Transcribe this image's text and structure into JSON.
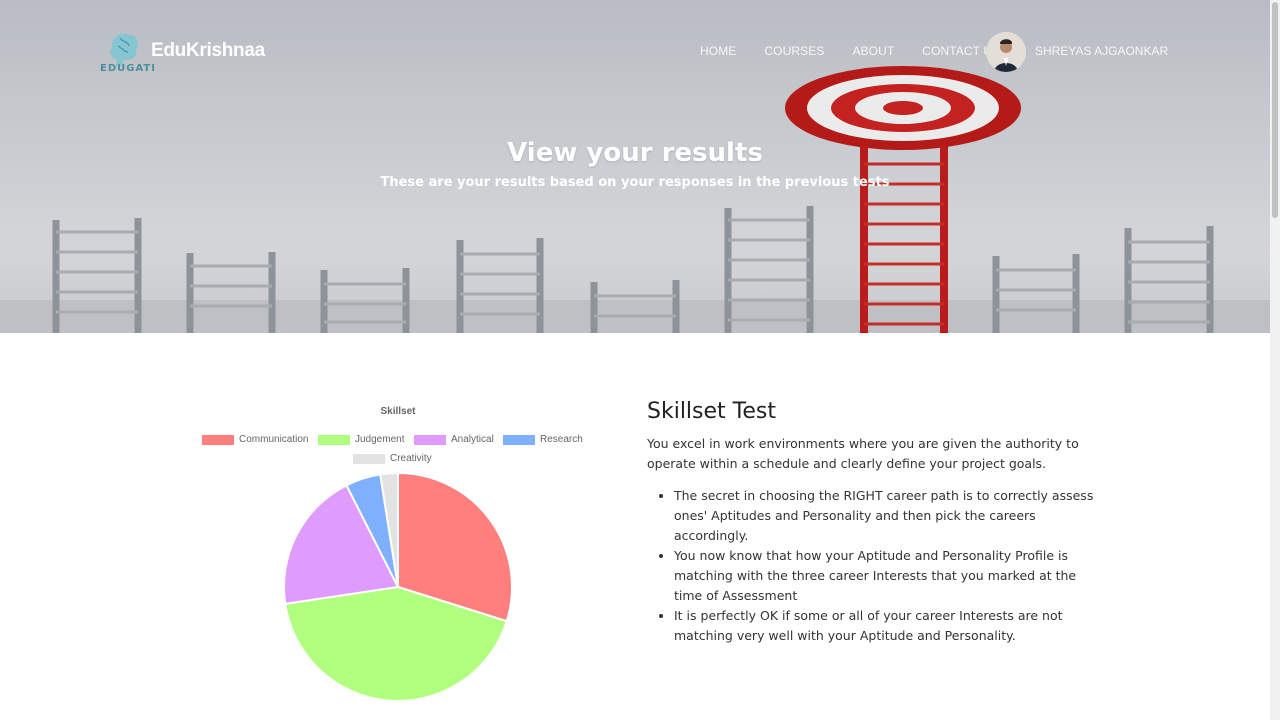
{
  "brand": {
    "name": "EduKrishnaa",
    "logo_caption": "EDUGATI",
    "logo_icon": "brain-icon"
  },
  "nav": {
    "items": [
      "HOME",
      "COURSES",
      "ABOUT",
      "CONTACT US"
    ],
    "user_name": "SHREYAS AJGAONKAR"
  },
  "hero": {
    "title": "View your results",
    "subtitle": "These are your results based on your responses in the previous tests"
  },
  "chart_data": {
    "type": "pie",
    "title": "Skillset",
    "categories": [
      "Communication",
      "Judgement",
      "Analytical",
      "Research",
      "Creativity"
    ],
    "values": [
      30,
      43,
      20,
      5,
      2.5
    ],
    "colors": [
      "#ff7f7f",
      "#b0ff7f",
      "#e09bff",
      "#7fb0ff",
      "#e3e3e3"
    ],
    "legend_position": "top"
  },
  "result": {
    "heading": "Skillset Test",
    "summary": "You excel in work environments where you are given the authority to operate within a schedule and clearly define your project goals.",
    "points": [
      "The secret in choosing the RIGHT career path is to correctly assess ones' Aptitudes and Personality and then pick the careers accordingly.",
      "You now know that how your Aptitude and Personality Profile is matching with the three career Interests that you marked at the time of Assessment",
      "It is perfectly OK if some or all of your career Interests are not matching very well with your Aptitude and Personality."
    ]
  }
}
